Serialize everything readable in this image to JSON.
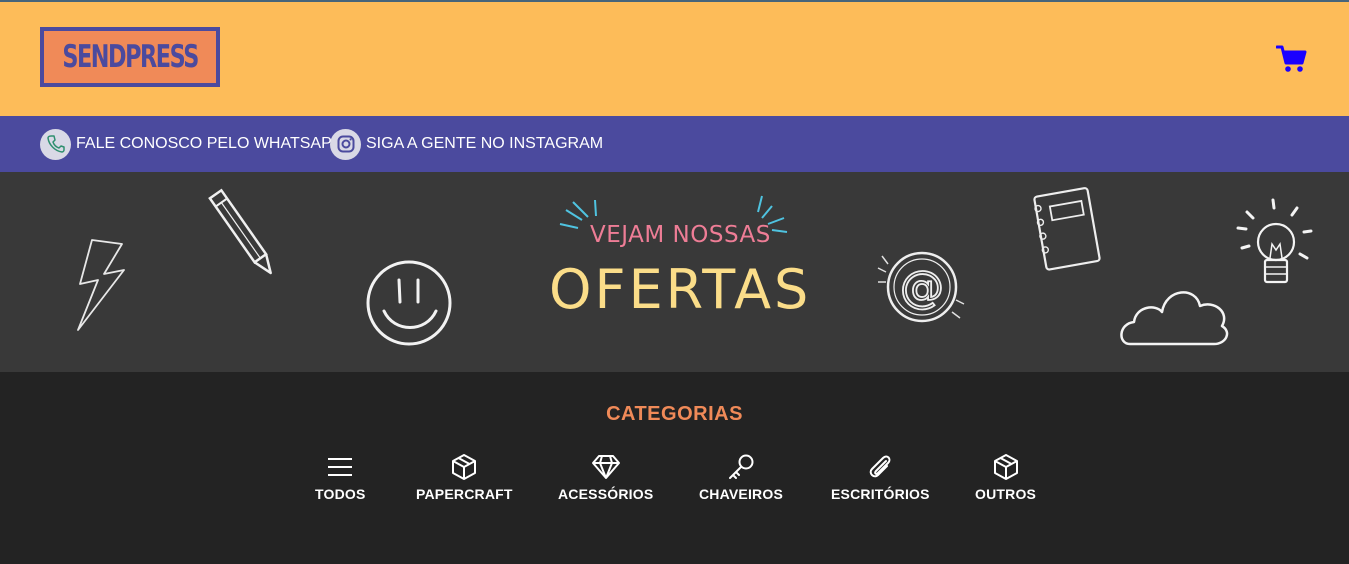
{
  "header": {
    "logo_text": "SENDPRESS",
    "cart_icon": "shopping-cart-icon",
    "colors": {
      "background": "#fdbc59",
      "logo_fill": "#f08a58",
      "logo_accent": "#4b4a9e",
      "cart": "#1a00ff"
    }
  },
  "contact_bar": {
    "background": "#4b4a9e",
    "items": [
      {
        "icon": "phone-icon",
        "label": "FALE CONOSCO PELO WHATSAPP"
      },
      {
        "icon": "instagram-icon",
        "label": "SIGA A GENTE NO INSTAGRAM"
      }
    ]
  },
  "banner": {
    "small_text": "VEJAM NOSSAS",
    "big_text": "OFERTAS",
    "colors": {
      "background": "#393939",
      "small_text": "#ee7d96",
      "big_text": "#fbdd89"
    }
  },
  "categories": {
    "title": "CATEGORIAS",
    "title_color": "#f08a58",
    "items": [
      {
        "icon": "menu-icon",
        "label": "TODOS"
      },
      {
        "icon": "box-icon",
        "label": "PAPERCRAFT"
      },
      {
        "icon": "diamond-icon",
        "label": "ACESSÓRIOS"
      },
      {
        "icon": "key-icon",
        "label": "CHAVEIROS"
      },
      {
        "icon": "paperclip-icon",
        "label": "ESCRITÓRIOS"
      },
      {
        "icon": "box-icon",
        "label": "OUTROS"
      }
    ]
  }
}
